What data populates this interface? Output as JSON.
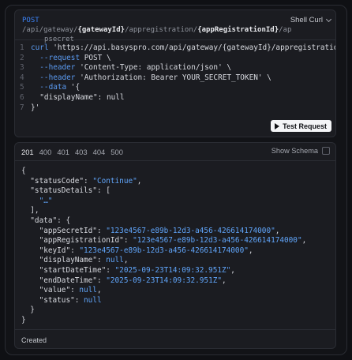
{
  "request": {
    "method": "POST",
    "url_parts": [
      "/api/gateway/",
      "{gatewayId}",
      "/appregistration/",
      "{appRegistrationId}",
      "/ap"
    ],
    "url_wrap": "psecret",
    "language": "Shell Curl",
    "code_lines": [
      {
        "n": "1",
        "kw": "curl",
        "text": " 'https://api.basyspro.com/api/gateway/{gatewayId}/appregistration/{a"
      },
      {
        "n": "2",
        "kw": "  --request",
        "text": " POST \\"
      },
      {
        "n": "3",
        "kw": "  --header",
        "text": " 'Content-Type: application/json' \\"
      },
      {
        "n": "4",
        "kw": "  --header",
        "text": " 'Authorization: Bearer YOUR_SECRET_TOKEN' \\"
      },
      {
        "n": "5",
        "kw": "  --data",
        "text": " '{"
      },
      {
        "n": "6",
        "kw": "",
        "text": "  \"displayName\": null"
      },
      {
        "n": "7",
        "kw": "",
        "text": "}'"
      }
    ],
    "test_button": "Test Request"
  },
  "response": {
    "tabs": [
      "201",
      "400",
      "401",
      "403",
      "404",
      "500"
    ],
    "active_tab": "201",
    "show_schema": "Show Schema",
    "json_lines": [
      {
        "k": "{",
        "v": ""
      },
      {
        "k": "  \"statusCode\": ",
        "v": "\"Continue\"",
        "t": ","
      },
      {
        "k": "  \"statusDetails\": [",
        "v": ""
      },
      {
        "k": "    ",
        "v": "\"…\""
      },
      {
        "k": "  ],",
        "v": ""
      },
      {
        "k": "  \"data\": {",
        "v": ""
      },
      {
        "k": "    \"appSecretId\": ",
        "v": "\"123e4567-e89b-12d3-a456-426614174000\"",
        "t": ","
      },
      {
        "k": "    \"appRegistrationId\": ",
        "v": "\"123e4567-e89b-12d3-a456-426614174000\"",
        "t": ","
      },
      {
        "k": "    \"keyId\": ",
        "v": "\"123e4567-e89b-12d3-a456-426614174000\"",
        "t": ","
      },
      {
        "k": "    \"displayName\": ",
        "v": "null",
        "t": ","
      },
      {
        "k": "    \"startDateTime\": ",
        "v": "\"2025-09-23T14:09:32.951Z\"",
        "t": ","
      },
      {
        "k": "    \"endDateTime\": ",
        "v": "\"2025-09-23T14:09:32.951Z\"",
        "t": ","
      },
      {
        "k": "    \"value\": ",
        "v": "null",
        "t": ","
      },
      {
        "k": "    \"status\": ",
        "v": "null"
      },
      {
        "k": "  }",
        "v": ""
      },
      {
        "k": "}",
        "v": ""
      }
    ],
    "status_description": "Created"
  }
}
